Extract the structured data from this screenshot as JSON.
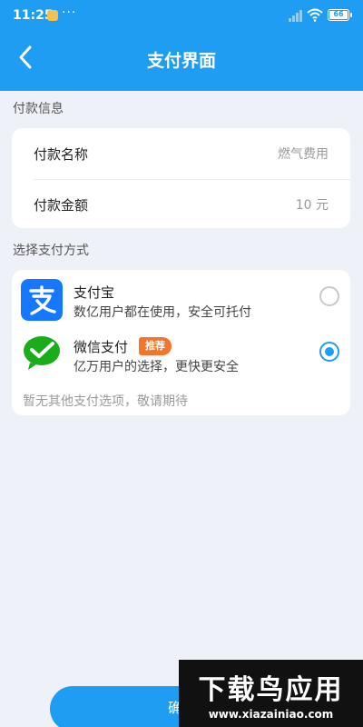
{
  "status_bar": {
    "time": "11:25",
    "dots": "···",
    "battery": "66"
  },
  "header": {
    "title": "支付界面"
  },
  "payment_info": {
    "section_label": "付款信息",
    "name_label": "付款名称",
    "name_value": "燃气费用",
    "amount_label": "付款金额",
    "amount_value": "10 元"
  },
  "payment_methods": {
    "section_label": "选择支付方式",
    "alipay": {
      "name": "支付宝",
      "desc": "数亿用户都在使用，安全可托付",
      "selected": false
    },
    "wechat": {
      "name": "微信支付",
      "badge": "推荐",
      "desc": "亿万用户的选择，更快更安全",
      "selected": true
    },
    "note": "暂无其他支付选项，敬请期待"
  },
  "confirm": {
    "label": "确认"
  },
  "watermark": {
    "title": "下载鸟应用",
    "url": "www.xiazainiao.com"
  },
  "colors": {
    "primary": "#1e9df2",
    "badge": "#f3752b",
    "alipay": "#1677ff",
    "wechat": "#1aad19"
  }
}
